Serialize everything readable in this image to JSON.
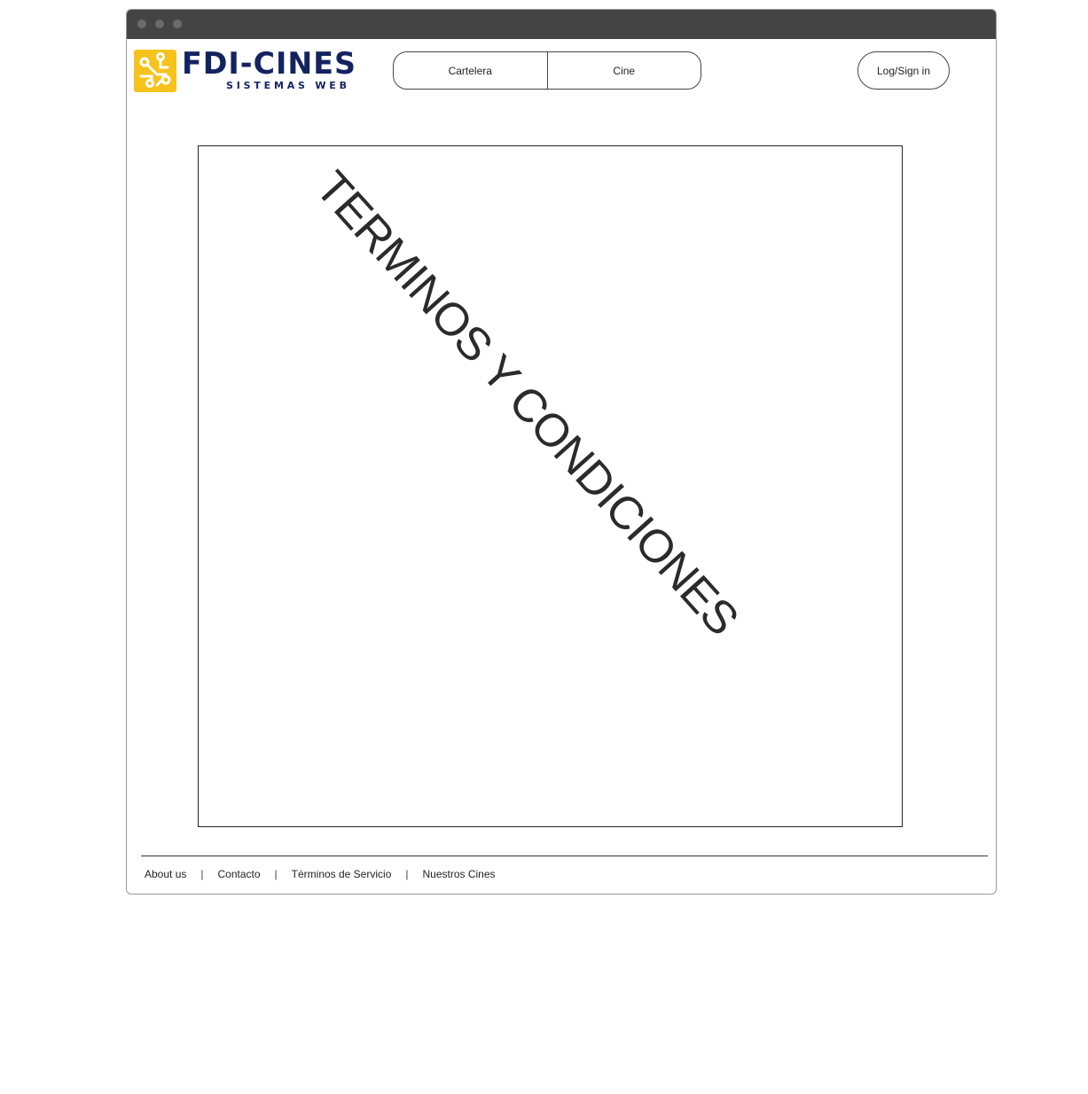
{
  "logo": {
    "title": "FDI-CINES",
    "subtitle": "SISTEMAS WEB",
    "brand_color": "#14235f",
    "icon_color": "#f6c21c"
  },
  "nav": {
    "items": [
      {
        "label": "Cartelera"
      },
      {
        "label": "Cine"
      }
    ]
  },
  "auth": {
    "login_label": "Log/Sign in"
  },
  "main": {
    "title": "TERMINOS Y CONDICIONES"
  },
  "footer": {
    "links": [
      {
        "label": "About us"
      },
      {
        "label": "Contacto"
      },
      {
        "label": "Términos de Servicio"
      },
      {
        "label": "Nuestros Cines"
      }
    ],
    "separator": "|"
  },
  "colors": {
    "titlebar": "#444444",
    "window_dots": "#6b6b6b"
  }
}
